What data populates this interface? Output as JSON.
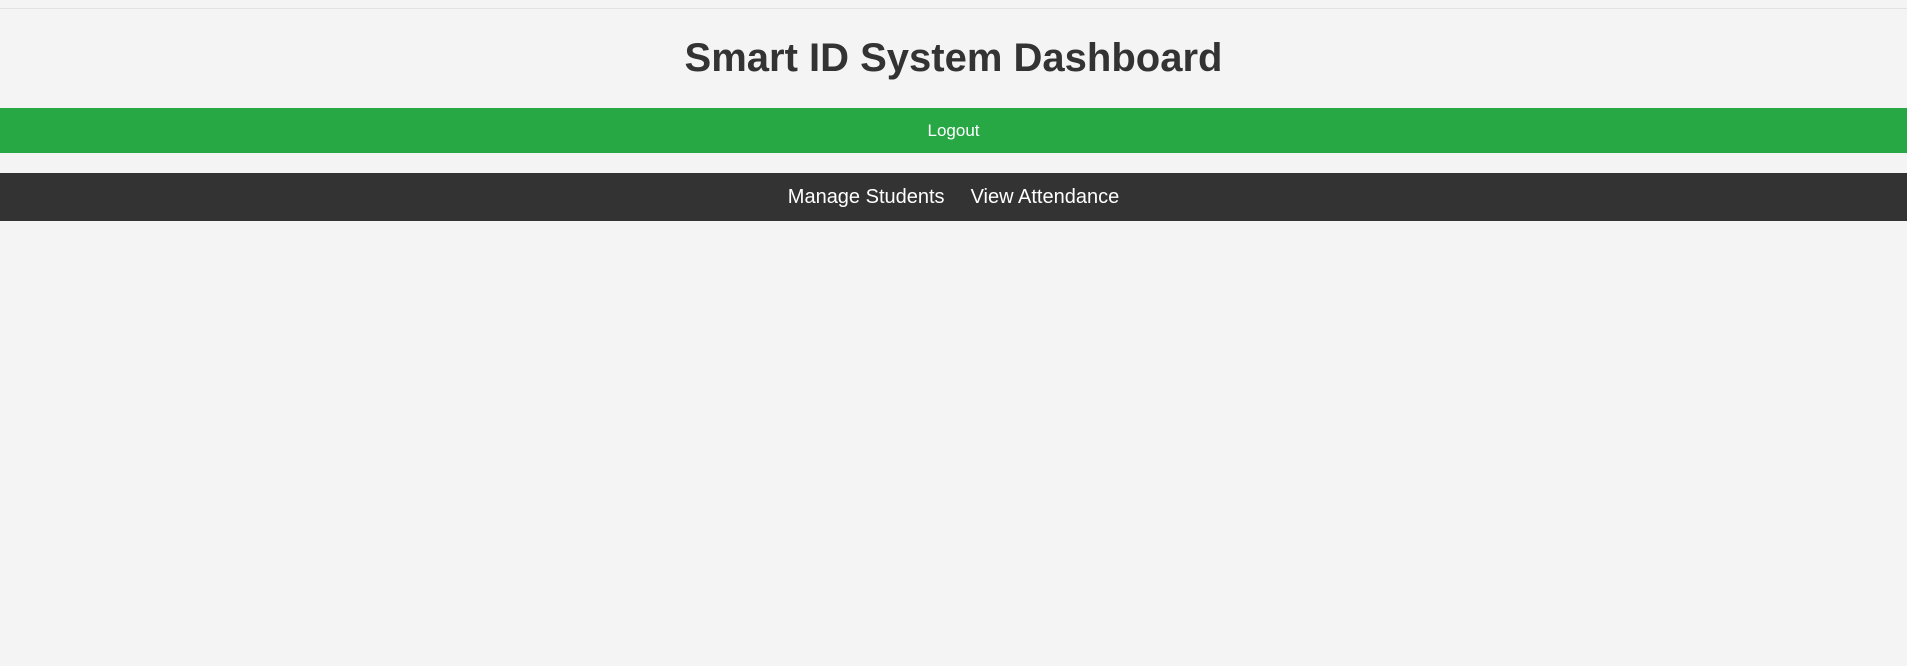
{
  "header": {
    "title": "Smart ID System Dashboard"
  },
  "actions": {
    "logout_label": "Logout"
  },
  "nav": {
    "items": [
      {
        "label": "Manage Students"
      },
      {
        "label": "View Attendance"
      }
    ]
  },
  "colors": {
    "background": "#f4f4f4",
    "title_text": "#333333",
    "logout_bg": "#28a745",
    "logout_text": "#ffffff",
    "nav_bg": "#333333",
    "nav_text": "#ffffff"
  }
}
